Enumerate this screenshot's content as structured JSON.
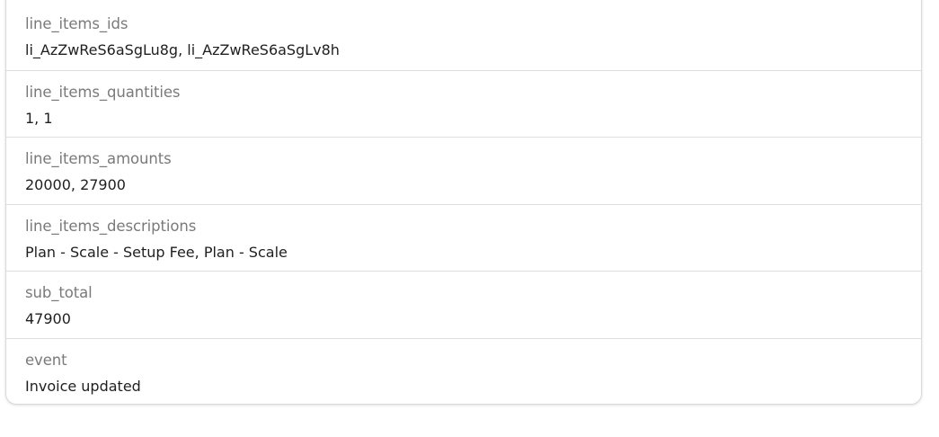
{
  "fields": [
    {
      "label": "line_items_ids",
      "value": "li_AzZwReS6aSgLu8g, li_AzZwReS6aSgLv8h"
    },
    {
      "label": "line_items_quantities",
      "value": "1, 1"
    },
    {
      "label": "line_items_amounts",
      "value": "20000, 27900"
    },
    {
      "label": "line_items_descriptions",
      "value": "Plan - Scale - Setup Fee, Plan - Scale"
    },
    {
      "label": "sub_total",
      "value": "47900"
    },
    {
      "label": "event",
      "value": "Invoice updated"
    }
  ]
}
